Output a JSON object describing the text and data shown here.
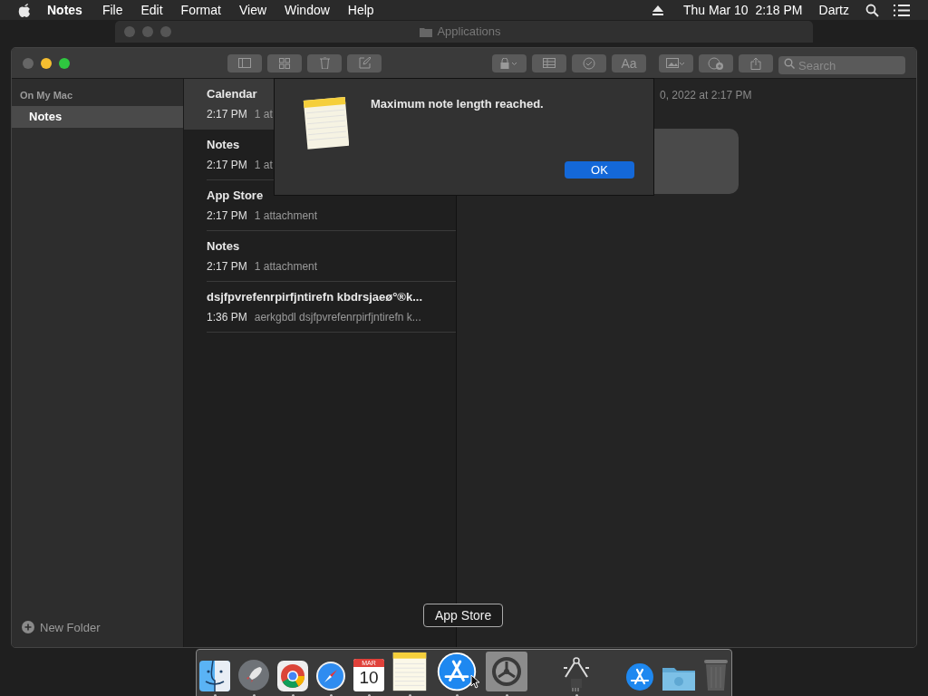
{
  "menu_bar": {
    "app": "Notes",
    "items": [
      "File",
      "Edit",
      "Format",
      "View",
      "Window",
      "Help"
    ],
    "clock": "Thu Mar 10  2:18 PM",
    "user": "Dartz"
  },
  "back_window": {
    "title": "Applications"
  },
  "toolbar": {
    "format_label": "Aa",
    "search": {
      "placeholder": "Search"
    }
  },
  "sidebar": {
    "section": "On My Mac",
    "items": [
      {
        "label": "Notes",
        "selected": true
      }
    ],
    "new_folder": "New Folder"
  },
  "notes": [
    {
      "title": "Calendar",
      "time": "2:17 PM",
      "preview": "1 at",
      "selected": true
    },
    {
      "title": "Notes",
      "time": "2:17 PM",
      "preview": "1 at",
      "selected": false
    },
    {
      "title": "App Store",
      "time": "2:17 PM",
      "preview": "1 attachment",
      "selected": false
    },
    {
      "title": "Notes",
      "time": "2:17 PM",
      "preview": "1 attachment",
      "selected": false
    },
    {
      "title": "dsjfpvrefenrpirfjntirefn kbdrsjaeø°®k...",
      "time": "1:36 PM",
      "preview": "aerkgbdl dsjfpvrefenrpirfjntirefn k...",
      "selected": false
    }
  ],
  "note_view": {
    "date": "0, 2022 at 2:17 PM"
  },
  "dialog": {
    "message": "Maximum note length reached.",
    "button": "OK"
  },
  "dock": {
    "tooltip": "App Store",
    "items": [
      {
        "kind": "finder",
        "running": true
      },
      {
        "kind": "rocket",
        "running": true
      },
      {
        "kind": "chrome",
        "running": true
      },
      {
        "kind": "compass",
        "running": true
      },
      {
        "kind": "calendar",
        "running": true,
        "month": "MAR",
        "day": "10"
      },
      {
        "kind": "notepad",
        "running": true
      },
      {
        "kind": "appstore",
        "running": true
      },
      {
        "kind": "gear",
        "running": true
      },
      {
        "kind": "separator"
      },
      {
        "kind": "caliper",
        "running": true
      },
      {
        "kind": "separator"
      },
      {
        "kind": "appstore-small",
        "running": false
      },
      {
        "kind": "folder",
        "running": false
      },
      {
        "kind": "trash",
        "running": false
      }
    ]
  }
}
